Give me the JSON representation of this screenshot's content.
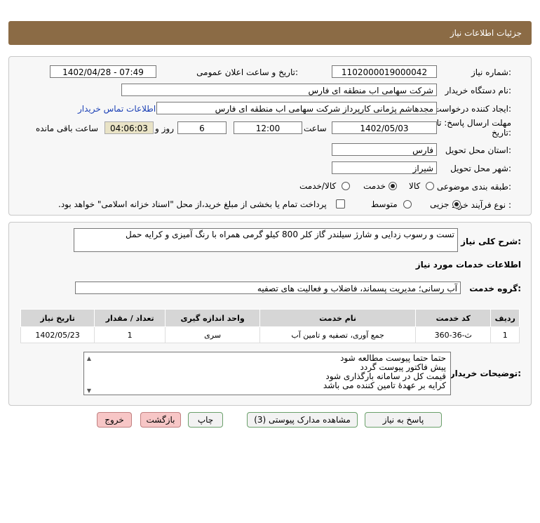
{
  "header": {
    "title": "جزئیات اطلاعات نیاز"
  },
  "form": {
    "need_number_label": "شماره نیاز:",
    "need_number": "1102000019000042",
    "announce_label": "تاریخ و ساعت اعلان عمومی:",
    "announce_value": "1402/04/28 - 07:49",
    "buyer_org_label": "نام دستگاه خریدار:",
    "buyer_org": "شرکت سهامی اب منطقه ای فارس",
    "requester_label": "ایجاد کننده درخواست:",
    "requester": "مجدهاشم پژمانی کارپرداز شرکت سهامی اب منطقه ای فارس",
    "contact_link": "اطلاعات تماس خریدار",
    "deadline_label_1": "مهلت ارسال پاسخ: تا",
    "deadline_label_2": "تاریخ:",
    "deadline_date": "1402/05/03",
    "time_label": "ساعت",
    "deadline_time": "12:00",
    "days_value": "6",
    "days_label": "روز و",
    "remaining_time": "04:06:03",
    "remaining_label": "ساعت باقی مانده",
    "province_label": "استان محل تحویل:",
    "province": "فارس",
    "city_label": "شهر محل تحویل:",
    "city": "شیراز",
    "category_label": "طبقه بندی موضوعی:",
    "category_options": [
      "کالا",
      "خدمت",
      "کالا/خدمت"
    ],
    "category_selected": "خدمت",
    "process_label": "نوع فرآیند خرید :",
    "process_options": [
      "جزیی",
      "متوسط"
    ],
    "process_selected": "جزیی",
    "payment_note": "پرداخت تمام یا بخشی از مبلغ خرید،از محل \"اسناد خزانه اسلامی\" خواهد بود."
  },
  "description": {
    "label": "شرح کلی نیاز:",
    "text": "تست و رسوب زدایی و شارژ سیلندر گاز کلر 800 کیلو گرمی همراه با رنگ آمیزی و کرایه حمل"
  },
  "services": {
    "section_title": "اطلاعات خدمات مورد نیاز",
    "group_label": "گروه خدمت:",
    "group_value": "آب رسانی؛ مدیریت پسماند، فاضلاب و فعالیت های تصفیه",
    "table": {
      "headers": [
        "ردیف",
        "کد خدمت",
        "نام خدمت",
        "واحد اندازه گیری",
        "تعداد / مقدار",
        "تاریخ نیاز"
      ],
      "rows": [
        [
          "1",
          "ث-36-360",
          "جمع آوری، تصفیه و تامین آب",
          "سری",
          "1",
          "1402/05/23"
        ]
      ]
    }
  },
  "buyer_notes": {
    "label": "توضیحات خریدار:",
    "lines": [
      "حتما حتما پیوست مطالعه شود",
      "پیش فاکتور پیوست گردد",
      "قیمت کل در سامانه بارگذاری شود",
      "کرایه بر عهدهٔ تامین کننده می باشد"
    ]
  },
  "buttons": {
    "reply": "پاسخ به نیاز",
    "attachments": "مشاهده مدارک پیوستی (3)",
    "print": "چاپ",
    "back": "بازگشت",
    "exit": "خروج"
  },
  "colors": {
    "header": "#8b6b45",
    "link": "#1a3fb5",
    "exit_button": "#f7c6c6"
  }
}
